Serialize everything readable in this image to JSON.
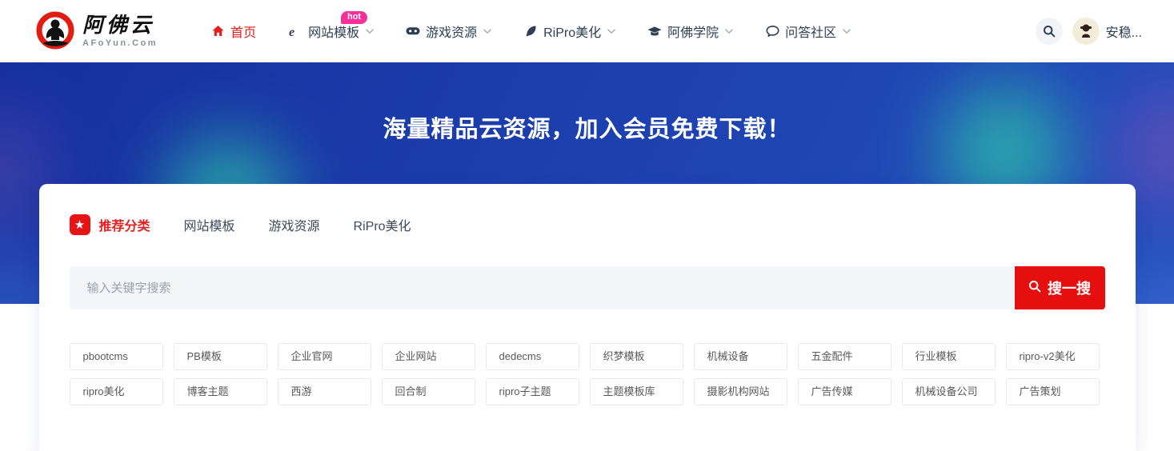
{
  "header": {
    "logo": {
      "title": "阿佛云",
      "subtitle": "AFoYun.Com"
    },
    "nav": [
      {
        "label": "首页",
        "icon": "home-icon",
        "active": true,
        "dropdown": false,
        "badge": ""
      },
      {
        "label": "网站模板",
        "icon": "browser-icon",
        "active": false,
        "dropdown": true,
        "badge": "hot"
      },
      {
        "label": "游戏资源",
        "icon": "gamepad-icon",
        "active": false,
        "dropdown": true,
        "badge": ""
      },
      {
        "label": "RiPro美化",
        "icon": "feather-icon",
        "active": false,
        "dropdown": true,
        "badge": ""
      },
      {
        "label": "阿佛学院",
        "icon": "graduation-icon",
        "active": false,
        "dropdown": true,
        "badge": ""
      },
      {
        "label": "问答社区",
        "icon": "comment-icon",
        "active": false,
        "dropdown": true,
        "badge": ""
      }
    ],
    "search_icon": "search-icon",
    "user": {
      "name": "安稳..."
    }
  },
  "hero": {
    "title": "海量精品云资源，加入会员免费下载！"
  },
  "panel": {
    "tabs": [
      {
        "label": "推荐分类",
        "active": true,
        "icon": "star-icon"
      },
      {
        "label": "网站模板",
        "active": false,
        "icon": ""
      },
      {
        "label": "游戏资源",
        "active": false,
        "icon": ""
      },
      {
        "label": "RiPro美化",
        "active": false,
        "icon": ""
      }
    ],
    "search": {
      "placeholder": "输入关键字搜索",
      "button_label": "搜一搜",
      "button_icon": "search-icon"
    },
    "tag_rows": [
      [
        "pbootcms",
        "PB模板",
        "企业官网",
        "企业网站",
        "dedecms",
        "织梦模板",
        "机械设备",
        "五金配件",
        "行业模板",
        "ripro-v2美化"
      ],
      [
        "ripro美化",
        "博客主题",
        "西游",
        "回合制",
        "ripro子主题",
        "主题模板库",
        "摄影机构网站",
        "广告传媒",
        "机械设备公司",
        "广告策划"
      ]
    ]
  },
  "colors": {
    "accent_red": "#e60f0f",
    "nav_text": "#2e3f54",
    "hot_badge": "#f5309b",
    "hero_blue_start": "#16309e",
    "hero_blue_end": "#2450bd",
    "hero_blob_teal": "#2ec3a8",
    "input_bg": "#f3f5f9"
  }
}
